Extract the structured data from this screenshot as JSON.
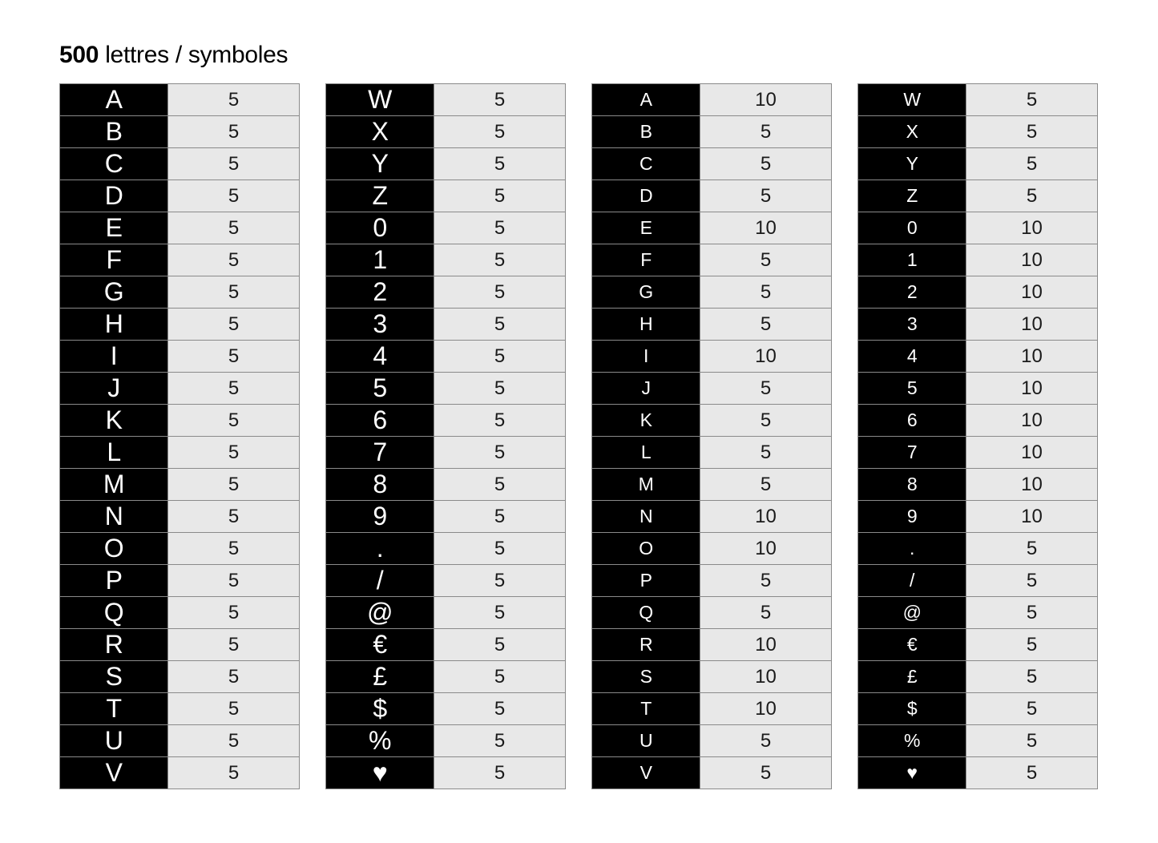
{
  "header": {
    "count": "500",
    "rest": " lettres / symboles"
  },
  "columns": [
    {
      "style": "big",
      "rows": [
        {
          "sym": "A",
          "qty": "5"
        },
        {
          "sym": "B",
          "qty": "5"
        },
        {
          "sym": "C",
          "qty": "5"
        },
        {
          "sym": "D",
          "qty": "5"
        },
        {
          "sym": "E",
          "qty": "5"
        },
        {
          "sym": "F",
          "qty": "5"
        },
        {
          "sym": "G",
          "qty": "5"
        },
        {
          "sym": "H",
          "qty": "5"
        },
        {
          "sym": "I",
          "qty": "5"
        },
        {
          "sym": "J",
          "qty": "5"
        },
        {
          "sym": "K",
          "qty": "5"
        },
        {
          "sym": "L",
          "qty": "5"
        },
        {
          "sym": "M",
          "qty": "5"
        },
        {
          "sym": "N",
          "qty": "5"
        },
        {
          "sym": "O",
          "qty": "5"
        },
        {
          "sym": "P",
          "qty": "5"
        },
        {
          "sym": "Q",
          "qty": "5"
        },
        {
          "sym": "R",
          "qty": "5"
        },
        {
          "sym": "S",
          "qty": "5"
        },
        {
          "sym": "T",
          "qty": "5"
        },
        {
          "sym": "U",
          "qty": "5"
        },
        {
          "sym": "V",
          "qty": "5"
        }
      ]
    },
    {
      "style": "big",
      "rows": [
        {
          "sym": "W",
          "qty": "5"
        },
        {
          "sym": "X",
          "qty": "5"
        },
        {
          "sym": "Y",
          "qty": "5"
        },
        {
          "sym": "Z",
          "qty": "5"
        },
        {
          "sym": "0",
          "qty": "5"
        },
        {
          "sym": "1",
          "qty": "5"
        },
        {
          "sym": "2",
          "qty": "5"
        },
        {
          "sym": "3",
          "qty": "5"
        },
        {
          "sym": "4",
          "qty": "5"
        },
        {
          "sym": "5",
          "qty": "5"
        },
        {
          "sym": "6",
          "qty": "5"
        },
        {
          "sym": "7",
          "qty": "5"
        },
        {
          "sym": "8",
          "qty": "5"
        },
        {
          "sym": "9",
          "qty": "5"
        },
        {
          "sym": ".",
          "qty": "5"
        },
        {
          "sym": "/",
          "qty": "5"
        },
        {
          "sym": "@",
          "qty": "5"
        },
        {
          "sym": "€",
          "qty": "5"
        },
        {
          "sym": "£",
          "qty": "5"
        },
        {
          "sym": "$",
          "qty": "5"
        },
        {
          "sym": "%",
          "qty": "5"
        },
        {
          "sym": "♥",
          "qty": "5"
        }
      ]
    },
    {
      "style": "small",
      "rows": [
        {
          "sym": "A",
          "qty": "10"
        },
        {
          "sym": "B",
          "qty": "5"
        },
        {
          "sym": "C",
          "qty": "5"
        },
        {
          "sym": "D",
          "qty": "5"
        },
        {
          "sym": "E",
          "qty": "10"
        },
        {
          "sym": "F",
          "qty": "5"
        },
        {
          "sym": "G",
          "qty": "5"
        },
        {
          "sym": "H",
          "qty": "5"
        },
        {
          "sym": "I",
          "qty": "10"
        },
        {
          "sym": "J",
          "qty": "5"
        },
        {
          "sym": "K",
          "qty": "5"
        },
        {
          "sym": "L",
          "qty": "5"
        },
        {
          "sym": "M",
          "qty": "5"
        },
        {
          "sym": "N",
          "qty": "10"
        },
        {
          "sym": "O",
          "qty": "10"
        },
        {
          "sym": "P",
          "qty": "5"
        },
        {
          "sym": "Q",
          "qty": "5"
        },
        {
          "sym": "R",
          "qty": "10"
        },
        {
          "sym": "S",
          "qty": "10"
        },
        {
          "sym": "T",
          "qty": "10"
        },
        {
          "sym": "U",
          "qty": "5"
        },
        {
          "sym": "V",
          "qty": "5"
        }
      ]
    },
    {
      "style": "small",
      "rows": [
        {
          "sym": "W",
          "qty": "5"
        },
        {
          "sym": "X",
          "qty": "5"
        },
        {
          "sym": "Y",
          "qty": "5"
        },
        {
          "sym": "Z",
          "qty": "5"
        },
        {
          "sym": "0",
          "qty": "10"
        },
        {
          "sym": "1",
          "qty": "10"
        },
        {
          "sym": "2",
          "qty": "10"
        },
        {
          "sym": "3",
          "qty": "10"
        },
        {
          "sym": "4",
          "qty": "10"
        },
        {
          "sym": "5",
          "qty": "10"
        },
        {
          "sym": "6",
          "qty": "10"
        },
        {
          "sym": "7",
          "qty": "10"
        },
        {
          "sym": "8",
          "qty": "10"
        },
        {
          "sym": "9",
          "qty": "10"
        },
        {
          "sym": ".",
          "qty": "5"
        },
        {
          "sym": "/",
          "qty": "5"
        },
        {
          "sym": "@",
          "qty": "5"
        },
        {
          "sym": "€",
          "qty": "5"
        },
        {
          "sym": "£",
          "qty": "5"
        },
        {
          "sym": "$",
          "qty": "5"
        },
        {
          "sym": "%",
          "qty": "5"
        },
        {
          "sym": "♥",
          "qty": "5"
        }
      ]
    }
  ]
}
